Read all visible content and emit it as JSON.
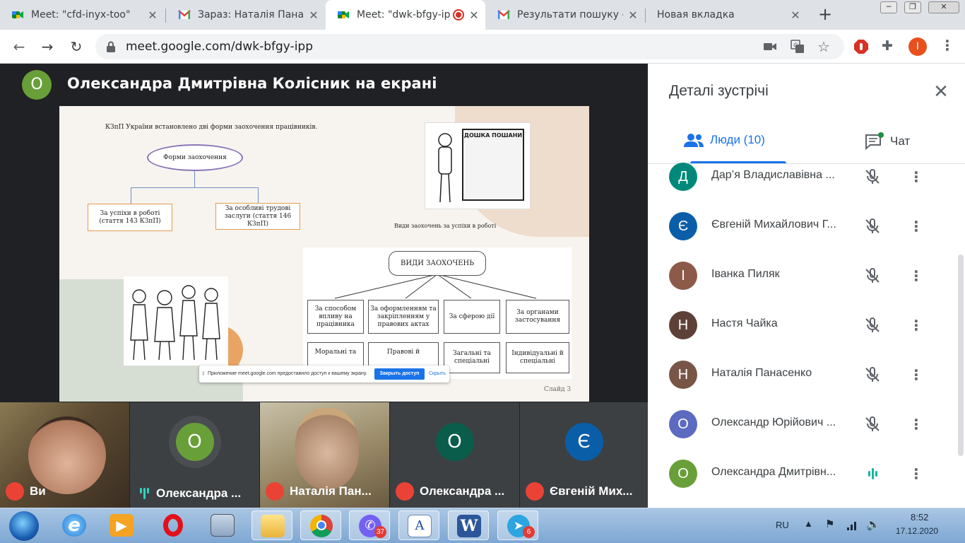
{
  "browser": {
    "tabs": [
      {
        "title": "Meet: \"cfd-inyx-too\"",
        "icon": "google-meet-icon",
        "active": false
      },
      {
        "title": "Зараз: Наталія Панасенко",
        "icon": "gmail-icon",
        "active": false
      },
      {
        "title": "Meet: \"dwk-bfgy-ipp\"",
        "icon": "google-meet-icon",
        "active": true,
        "recording": true
      },
      {
        "title": "Результати пошуку - ",
        "icon": "gmail-icon",
        "active": false
      },
      {
        "title": "Новая вкладка",
        "icon": "",
        "active": false
      }
    ],
    "new_tab": "+",
    "url": "meet.google.com/dwk-bfgy-ipp",
    "profile_initial": "I",
    "window_controls": [
      "minimize-icon",
      "restore-icon",
      "close-icon"
    ]
  },
  "presentation": {
    "presenter_initial": "О",
    "presenter_color": "#689f38",
    "title": "Олександра Дмитрівна Колісник на екрані",
    "slide": {
      "intro": "КЗпП України встановлено дві форми заохочення працівників.",
      "root_ellipse": "Форми заохочення",
      "branch_left": "За успіхи в роботі (стаття 143 КЗпП)",
      "branch_right": "За особливі трудові заслуги (стаття 146 КЗпП)",
      "types_caption": "Види заохочень за успіхи в роботі",
      "poster_title": "ДОШКА ПОШАНИ",
      "types_root": "ВИДИ ЗАОХОЧЕНЬ",
      "types": [
        {
          "label": "За способом впливу на працівника",
          "sub": "Моральні та"
        },
        {
          "label": "За оформленням та закріпленням у правових актах",
          "sub": "Правові й"
        },
        {
          "label": "За сферою дії",
          "sub": "Загальні та спеціальні"
        },
        {
          "label": "За органами застосування",
          "sub": "Індивідуальні й спеціальні"
        }
      ],
      "slide_number": "Слайд  3"
    },
    "share_bar": {
      "message": "Приложение meet.google.com предоставило доступ к вашему экрану.",
      "stop_button": "Закрыть доступ",
      "hide_button": "Скрыть"
    }
  },
  "tiles": [
    {
      "name": "Ви",
      "muted": true,
      "video": true,
      "initial": "",
      "color": ""
    },
    {
      "name": "Олександра ...",
      "muted": false,
      "video": false,
      "initial": "О",
      "color": "#689f38"
    },
    {
      "name": "Наталія Пан...",
      "muted": true,
      "video": true,
      "initial": "",
      "color": ""
    },
    {
      "name": "Олександра ...",
      "muted": true,
      "video": false,
      "initial": "О",
      "color": "#0b5d4b"
    },
    {
      "name": "Євгеній Мих...",
      "muted": true,
      "video": false,
      "initial": "Є",
      "color": "#0a5ea8"
    }
  ],
  "panel": {
    "title": "Деталі зустрічі",
    "tab_people": "Люди (10)",
    "tab_chat": "Чат",
    "participants": [
      {
        "initial": "Д",
        "name": "Дар’я Владиславівна ...",
        "color": "#00897b",
        "muted": true
      },
      {
        "initial": "Є",
        "name": "Євгеній Михайлович Г...",
        "color": "#0a5ea8",
        "muted": true
      },
      {
        "initial": "І",
        "name": "Іванка Пиляк",
        "color": "#8d5a4a",
        "muted": true
      },
      {
        "initial": "Н",
        "name": "Настя Чайка",
        "color": "#5d4037",
        "muted": true
      },
      {
        "initial": "Н",
        "name": "Наталія Панасенко",
        "color": "#795548",
        "muted": true
      },
      {
        "initial": "О",
        "name": "Олександр Юрійович ...",
        "color": "#5c6bc0",
        "muted": true
      },
      {
        "initial": "О",
        "name": "Олександра Дмитрівн...",
        "color": "#689f38",
        "muted": false
      }
    ]
  },
  "taskbar": {
    "apps": [
      {
        "name": "start-orb-icon",
        "badge": ""
      },
      {
        "name": "internet-explorer-icon",
        "badge": ""
      },
      {
        "name": "media-player-icon",
        "badge": ""
      },
      {
        "name": "opera-icon",
        "badge": ""
      },
      {
        "name": "calculator-icon",
        "badge": ""
      },
      {
        "name": "explorer-folder-icon",
        "badge": ""
      },
      {
        "name": "chrome-icon",
        "badge": ""
      },
      {
        "name": "viber-icon",
        "badge": "37"
      },
      {
        "name": "wordpad-icon",
        "badge": ""
      },
      {
        "name": "word-icon",
        "badge": ""
      },
      {
        "name": "telegram-icon",
        "badge": "6"
      }
    ],
    "language": "RU",
    "time": "8:52",
    "date": "17.12.2020"
  }
}
